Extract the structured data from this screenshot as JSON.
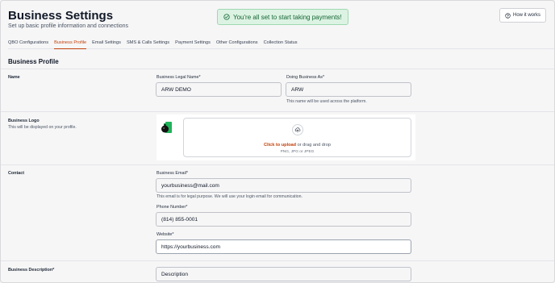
{
  "page": {
    "title": "Business Settings",
    "subtitle": "Set up basic profile information and connections",
    "toast": "You're all set to start taking payments!",
    "how_it_works": "How it works"
  },
  "tabs": [
    {
      "label": "QBO Configurations"
    },
    {
      "label": "Business Profile"
    },
    {
      "label": "Email Settings"
    },
    {
      "label": "SMS & Calls Settings"
    },
    {
      "label": "Payment Settings"
    },
    {
      "label": "Other Configurations"
    },
    {
      "label": "Collection Status"
    }
  ],
  "profile": {
    "section_title": "Business Profile",
    "name_label": "Name",
    "legal_name_label": "Business Legal Name*",
    "legal_name_value": "ARW DEMO",
    "dba_label": "Doing Business As*",
    "dba_value": "ARW",
    "dba_help": "This name will be used across the platform.",
    "logo_label": "Business Logo",
    "logo_help": "This will be displayed on your profile.",
    "upload_link": "Click to upload",
    "upload_rest": " or drag and drop",
    "upload_hint": "PNG, JPG or JPEG",
    "contact_label": "Contact",
    "email_label": "Business Email*",
    "email_value": "yourbusiness@mail.com",
    "email_help": "This email is for legal purpose. We will use your login email for communication.",
    "phone_label": "Phone Number*",
    "phone_value": "(814) 855-0001",
    "website_label": "Website*",
    "website_value": "https://yourbusiness.com",
    "description_label": "Business Description*",
    "description_value": "Description"
  },
  "colors": {
    "accent": "#c2410c",
    "success": "#166534",
    "success_bg": "#dcf3e3"
  },
  "icons": {
    "toast": "check-circle-icon",
    "how_it_works": "help-circle-icon",
    "upload": "cloud-upload-icon"
  }
}
